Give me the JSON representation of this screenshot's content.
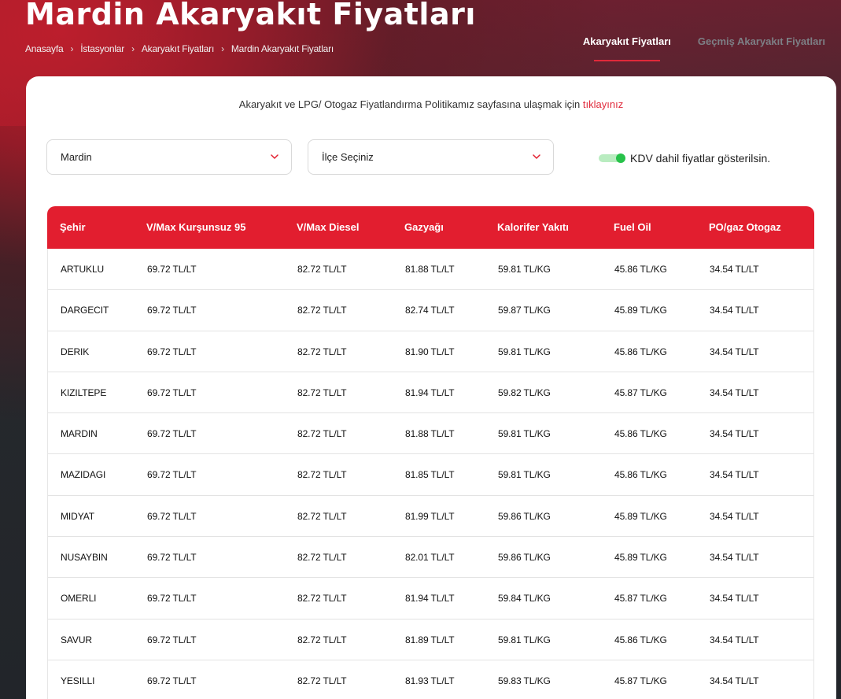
{
  "header": {
    "title": "Mardin Akaryakıt Fiyatları",
    "breadcrumb": [
      "Anasayfa",
      "İstasyonlar",
      "Akaryakıt Fiyatları",
      "Mardin Akaryakıt Fiyatları"
    ],
    "breadcrumb_separator": "›",
    "tabs": [
      {
        "label": "Akaryakıt Fiyatları",
        "active": true
      },
      {
        "label": "Geçmiş Akaryakıt Fiyatları",
        "active": false
      }
    ]
  },
  "policy": {
    "text": "Akaryakıt ve LPG/ Otogaz Fiyatlandırma Politikamız sayfasına ulaşmak için ",
    "link": "tıklayınız"
  },
  "filters": {
    "city": "Mardin",
    "district": "İlçe Seçiniz",
    "kdv_toggle_on": true,
    "kdv_label": "KDV dahil fiyatlar gösterilsin."
  },
  "colors": {
    "accent": "#e21e2f",
    "toggle_on": "#27c24a"
  },
  "icons": {
    "dropdown": "chevron-down-icon"
  },
  "table": {
    "headers": [
      "Şehir",
      "V/Max Kurşunsuz 95",
      "V/Max Diesel",
      "Gazyağı",
      "Kalorifer Yakıtı",
      "Fuel Oil",
      "PO/gaz Otogaz"
    ],
    "rows": [
      [
        "ARTUKLU",
        "69.72 TL/LT",
        "82.72 TL/LT",
        "81.88 TL/LT",
        "59.81 TL/KG",
        "45.86 TL/KG",
        "34.54 TL/LT"
      ],
      [
        "DARGECIT",
        "69.72 TL/LT",
        "82.72 TL/LT",
        "82.74 TL/LT",
        "59.87 TL/KG",
        "45.89 TL/KG",
        "34.54 TL/LT"
      ],
      [
        "DERIK",
        "69.72 TL/LT",
        "82.72 TL/LT",
        "81.90 TL/LT",
        "59.81 TL/KG",
        "45.86 TL/KG",
        "34.54 TL/LT"
      ],
      [
        "KIZILTEPE",
        "69.72 TL/LT",
        "82.72 TL/LT",
        "81.94 TL/LT",
        "59.82 TL/KG",
        "45.87 TL/KG",
        "34.54 TL/LT"
      ],
      [
        "MARDIN",
        "69.72 TL/LT",
        "82.72 TL/LT",
        "81.88 TL/LT",
        "59.81 TL/KG",
        "45.86 TL/KG",
        "34.54 TL/LT"
      ],
      [
        "MAZIDAGI",
        "69.72 TL/LT",
        "82.72 TL/LT",
        "81.85 TL/LT",
        "59.81 TL/KG",
        "45.86 TL/KG",
        "34.54 TL/LT"
      ],
      [
        "MIDYAT",
        "69.72 TL/LT",
        "82.72 TL/LT",
        "81.99 TL/LT",
        "59.86 TL/KG",
        "45.89 TL/KG",
        "34.54 TL/LT"
      ],
      [
        "NUSAYBIN",
        "69.72 TL/LT",
        "82.72 TL/LT",
        "82.01 TL/LT",
        "59.86 TL/KG",
        "45.89 TL/KG",
        "34.54 TL/LT"
      ],
      [
        "OMERLI",
        "69.72 TL/LT",
        "82.72 TL/LT",
        "81.94 TL/LT",
        "59.84 TL/KG",
        "45.87 TL/KG",
        "34.54 TL/LT"
      ],
      [
        "SAVUR",
        "69.72 TL/LT",
        "82.72 TL/LT",
        "81.89 TL/LT",
        "59.81 TL/KG",
        "45.86 TL/KG",
        "34.54 TL/LT"
      ],
      [
        "YESILLI",
        "69.72 TL/LT",
        "82.72 TL/LT",
        "81.93 TL/LT",
        "59.83 TL/KG",
        "45.87 TL/KG",
        "34.54 TL/LT"
      ]
    ]
  }
}
